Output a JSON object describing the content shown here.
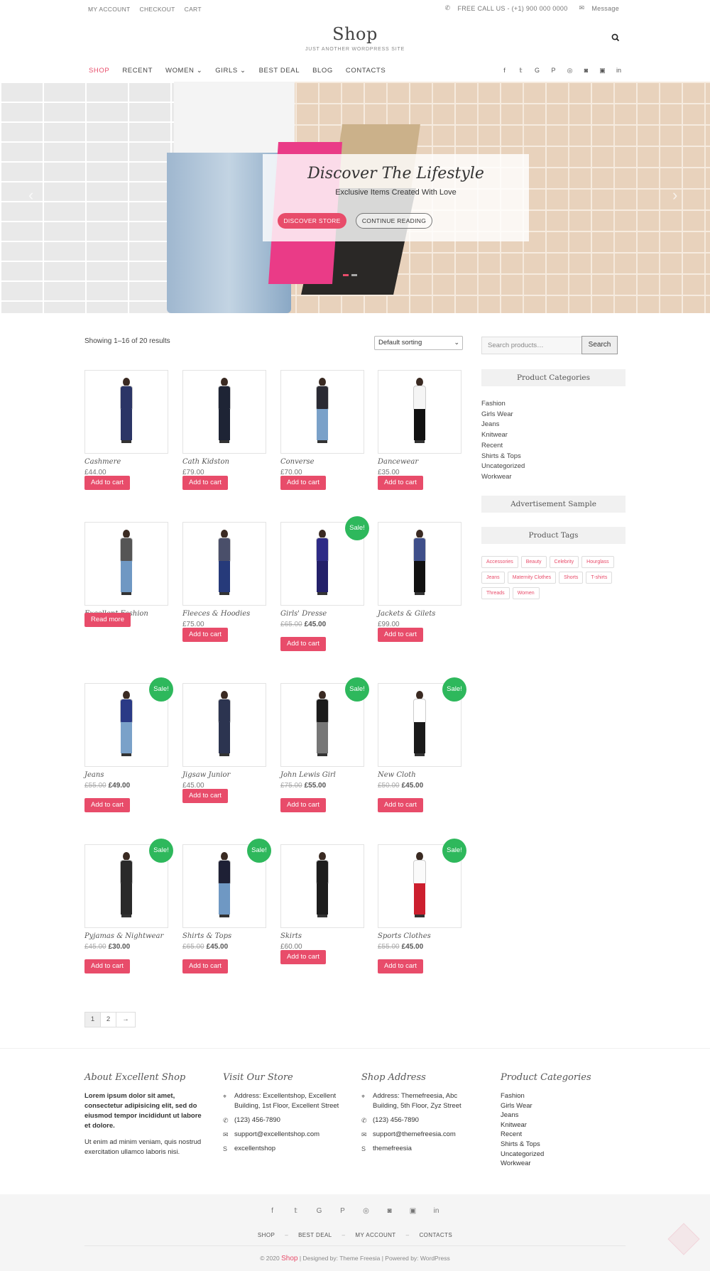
{
  "topbar": {
    "links": [
      "MY ACCOUNT",
      "CHECKOUT",
      "CART"
    ],
    "call": "FREE CALL US - (+1) 900 000 0000",
    "message": "Message"
  },
  "site": {
    "title": "Shop",
    "description": "JUST ANOTHER WORDPRESS SITE"
  },
  "nav": {
    "items": [
      "SHOP",
      "RECENT",
      "WOMEN",
      "GIRLS",
      "BEST DEAL",
      "BLOG",
      "CONTACTS"
    ]
  },
  "social": [
    "facebook-icon",
    "twitter-icon",
    "google-plus-icon",
    "pinterest-icon",
    "dribbble-icon",
    "instagram-icon",
    "flickr-icon",
    "linkedin-icon"
  ],
  "hero": {
    "title": "Discover The Lifestyle",
    "subtitle": "Exclusive Items Created With Love",
    "primary_button": "DISCOVER STORE",
    "secondary_button": "CONTINUE READING"
  },
  "shop": {
    "result_count": "Showing 1–16 of 20 results",
    "sorting": "Default sorting",
    "sale_label": "Sale!",
    "products": [
      {
        "name": "Cashmere",
        "price": "£44.00",
        "old_price": "",
        "sale": false,
        "button": "Add to cart"
      },
      {
        "name": "Cath Kidston",
        "price": "£79.00",
        "old_price": "",
        "sale": false,
        "button": "Add to cart"
      },
      {
        "name": "Converse",
        "price": "£70.00",
        "old_price": "",
        "sale": false,
        "button": "Add to cart"
      },
      {
        "name": "Dancewear",
        "price": "£35.00",
        "old_price": "",
        "sale": false,
        "button": "Add to cart"
      },
      {
        "name": "Excellent Fashion",
        "price": "",
        "old_price": "",
        "sale": false,
        "button": "Read more"
      },
      {
        "name": "Fleeces & Hoodies",
        "price": "£75.00",
        "old_price": "",
        "sale": false,
        "button": "Add to cart"
      },
      {
        "name": "Girls' Dresse",
        "price": "£45.00",
        "old_price": "£65.00",
        "sale": true,
        "button": "Add to cart"
      },
      {
        "name": "Jackets & Gilets",
        "price": "£99.00",
        "old_price": "",
        "sale": false,
        "button": "Add to cart"
      },
      {
        "name": "Jeans",
        "price": "£49.00",
        "old_price": "£55.00",
        "sale": true,
        "button": "Add to cart"
      },
      {
        "name": "Jigsaw Junior",
        "price": "£45.00",
        "old_price": "",
        "sale": false,
        "button": "Add to cart"
      },
      {
        "name": "John Lewis Girl",
        "price": "£55.00",
        "old_price": "£75.00",
        "sale": true,
        "button": "Add to cart"
      },
      {
        "name": "New Cloth",
        "price": "£45.00",
        "old_price": "£50.00",
        "sale": true,
        "button": "Add to cart"
      },
      {
        "name": "Pyjamas & Nightwear",
        "price": "£30.00",
        "old_price": "£45.00",
        "sale": true,
        "button": "Add to cart"
      },
      {
        "name": "Shirts & Tops",
        "price": "£45.00",
        "old_price": "£65.00",
        "sale": true,
        "button": "Add to cart"
      },
      {
        "name": "Skirts",
        "price": "£60.00",
        "old_price": "",
        "sale": false,
        "button": "Add to cart"
      },
      {
        "name": "Sports Clothes",
        "price": "£45.00",
        "old_price": "£55.00",
        "sale": true,
        "button": "Add to cart"
      }
    ],
    "pagination": [
      "1",
      "2",
      "→"
    ]
  },
  "sidebar": {
    "search_placeholder": "Search products…",
    "search_button": "Search",
    "categories_title": "Product Categories",
    "categories": [
      "Fashion",
      "Girls Wear",
      "Jeans",
      "Knitwear",
      "Recent",
      "Shirts & Tops",
      "Uncategorized",
      "Workwear"
    ],
    "ad_title": "Advertisement Sample",
    "tags_title": "Product Tags",
    "tags": [
      "Accessories",
      "Beauty",
      "Celebrity",
      "Hourglass",
      "Jeans",
      "Maternity Clothes",
      "Shorts",
      "T-shirts",
      "Threads",
      "Women"
    ]
  },
  "footer": {
    "about": {
      "title": "About Excellent Shop",
      "bold": "Lorem ipsum dolor sit amet, consectetur adipisicing elit, sed do eiusmod tempor incididunt ut labore et dolore.",
      "text": "Ut enim ad minim veniam, quis nostrud exercitation ullamco laboris nisi."
    },
    "store": {
      "title": "Visit Our Store",
      "address": "Address: Excellentshop, Excellent Building, 1st Floor, Excellent Street",
      "phone": "(123) 456-7890",
      "email": "support@excellentshop.com",
      "skype": "excellentshop"
    },
    "shop_address": {
      "title": "Shop Address",
      "address": "Address: Themefreesia, Abc Building, 5th Floor, Zyz Street",
      "phone": "(123) 456-7890",
      "email": "support@themefreesia.com",
      "skype": "themefreesia"
    },
    "categories": {
      "title": "Product Categories",
      "items": [
        "Fashion",
        "Girls Wear",
        "Jeans",
        "Knitwear",
        "Recent",
        "Shirts & Tops",
        "Uncategorized",
        "Workwear"
      ]
    },
    "bottom_nav": [
      "SHOP",
      "BEST DEAL",
      "MY ACCOUNT",
      "CONTACTS"
    ],
    "copyright_prefix": "© 2020 ",
    "copyright_brand": "Shop",
    "copyright_suffix": " | Designed by: Theme Freesia | Powered by: WordPress"
  },
  "colors": {
    "accent": "#e84c6a",
    "sale": "#2eb85c"
  }
}
